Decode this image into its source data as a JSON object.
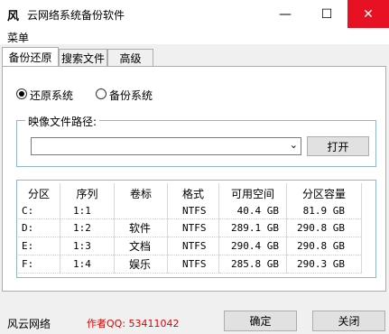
{
  "window": {
    "app_icon": "风",
    "title": "云网络系统备份软件",
    "minimize": "—",
    "maximize": "☐",
    "close": "✕"
  },
  "menu": {
    "label": "菜单"
  },
  "tabs": [
    {
      "label": "备份还原"
    },
    {
      "label": "搜索文件"
    },
    {
      "label": "高级"
    }
  ],
  "mode": {
    "restore_label": "还原系统",
    "backup_label": "备份系统",
    "selected": "restore"
  },
  "image_path": {
    "legend": "映像文件路径:",
    "value": "",
    "open_button": "打开"
  },
  "partitions": {
    "headers": [
      "分区",
      "序列",
      "卷标",
      "格式",
      "可用空间",
      "分区容量"
    ],
    "rows": [
      [
        "C:",
        "1:1",
        "",
        "NTFS",
        "40.4 GB",
        "81.9 GB"
      ],
      [
        "D:",
        "1:2",
        "软件",
        "NTFS",
        "289.1 GB",
        "290.8 GB"
      ],
      [
        "E:",
        "1:3",
        "文档",
        "NTFS",
        "290.4 GB",
        "290.8 GB"
      ],
      [
        "F:",
        "1:4",
        "娱乐",
        "NTFS",
        "285.8 GB",
        "290.3 GB"
      ]
    ]
  },
  "footer": {
    "brand": "风云网络",
    "author": "作者QQ: 53411042",
    "ok_button": "确定",
    "close_button": "关闭"
  },
  "colors": {
    "close_hover": "#e81123",
    "author_text": "#e00000",
    "group_border": "#8fb6d6"
  }
}
